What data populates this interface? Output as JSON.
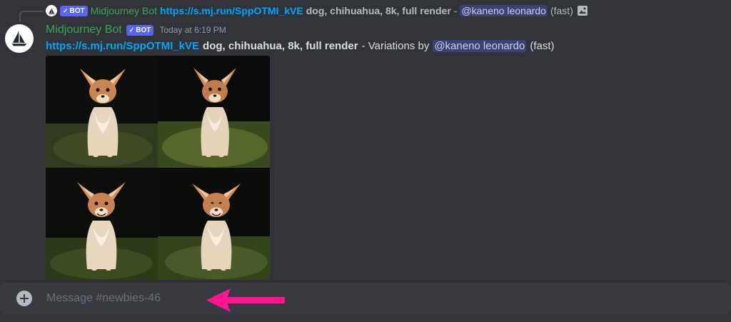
{
  "reply_preview": {
    "author": "Midjourney Bot",
    "bot_tag": "BOT",
    "bot_check": "✓",
    "link": "https://s.mj.run/SppOTMI_kVE",
    "prompt": "dog, chihuahua, 8k, full render",
    "separator": "-",
    "mention": "@kaneno leonardo",
    "speed": "(fast)",
    "attachment_icon": "image-icon"
  },
  "message": {
    "author": "Midjourney Bot",
    "bot_tag": "BOT",
    "bot_check": "✓",
    "timestamp": "Today at 6:19 PM",
    "link": "https://s.mj.run/SppOTMI_kVE",
    "prompt": "dog, chihuahua, 8k, full render",
    "suffix": "- Variations by",
    "mention": "@kaneno leonardo",
    "speed": "(fast)",
    "avatar_icon": "sailboat-icon",
    "image_grid": {
      "tiles": [
        "chihuahua-variation-1",
        "chihuahua-variation-2",
        "chihuahua-variation-3",
        "chihuahua-variation-4"
      ]
    }
  },
  "composer": {
    "placeholder": "Message #newbies-46",
    "add_icon": "plus-icon"
  },
  "annotation": {
    "arrow_color": "#ff1493",
    "arrow_icon": "arrow-left-icon"
  },
  "colors": {
    "background": "#313338",
    "username_green": "#3ba55d",
    "link_blue": "#00a8fc",
    "bot_tag": "#5865f2"
  }
}
